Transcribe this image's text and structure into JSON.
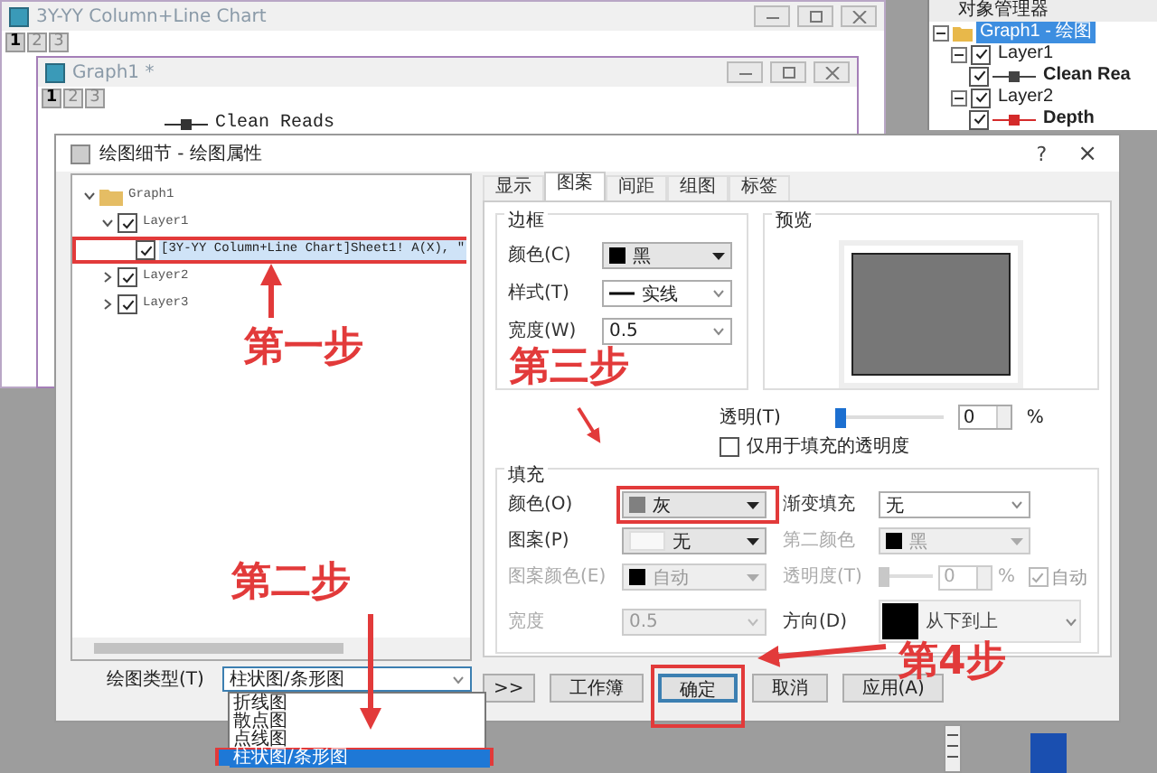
{
  "background_window": {
    "title": "3Y-YY Column+Line Chart",
    "page_tabs": [
      {
        "label": "1",
        "selected": true
      },
      {
        "label": "2",
        "selected": false
      },
      {
        "label": "3",
        "selected": false
      }
    ]
  },
  "graph_window": {
    "title": "Graph1 *",
    "page_tabs": [
      {
        "label": "1",
        "selected": true
      },
      {
        "label": "2",
        "selected": false
      },
      {
        "label": "3",
        "selected": false
      }
    ],
    "legend": "Clean Reads"
  },
  "object_manager": {
    "title": "对象管理器",
    "tree": [
      {
        "label": "Graph1 - 绘图",
        "kind": "graph",
        "selected": true,
        "children": [
          {
            "label": "Layer1",
            "kind": "layer",
            "checked": true,
            "selected": false,
            "children": [
              {
                "label": "Clean Rea",
                "kind": "plot",
                "checked": true,
                "selected": false,
                "color": "#444444"
              }
            ]
          },
          {
            "label": "Layer2",
            "kind": "layer",
            "checked": true,
            "selected": false,
            "children": [
              {
                "label": "Depth",
                "kind": "plot",
                "checked": true,
                "selected": false,
                "color": "#d42a2a"
              }
            ]
          }
        ]
      }
    ]
  },
  "dialog": {
    "title": "绘图细节 - 绘图属性",
    "help": "?",
    "close": "×"
  },
  "plot_tree": [
    {
      "label": "Graph1",
      "expanded": true,
      "selected": false,
      "highlighted": false,
      "children": [
        {
          "label": "Layer1",
          "expanded": true,
          "checked": true,
          "selected": false,
          "highlighted": false,
          "children": [
            {
              "label": "[3Y-YY Column+Line Chart]Sheet1! A(X), \"",
              "checked": true,
              "selected": true,
              "highlighted": true
            }
          ]
        },
        {
          "label": "Layer2",
          "expanded": false,
          "checked": true,
          "selected": false,
          "highlighted": false
        },
        {
          "label": "Layer3",
          "expanded": false,
          "checked": true,
          "selected": false,
          "highlighted": false
        }
      ]
    }
  ],
  "plot_type": {
    "label": "绘图类型(T)",
    "value": "柱状图/条形图",
    "options": [
      {
        "label": "折线图",
        "selected": false,
        "highlighted": false
      },
      {
        "label": "散点图",
        "selected": false,
        "highlighted": false
      },
      {
        "label": "点线图",
        "selected": false,
        "highlighted": false
      },
      {
        "label": "柱状图/条形图",
        "selected": true,
        "highlighted": true
      }
    ]
  },
  "tabs": [
    {
      "label": "显示",
      "selected": false
    },
    {
      "label": "图案",
      "selected": true
    },
    {
      "label": "间距",
      "selected": false
    },
    {
      "label": "组图",
      "selected": false
    },
    {
      "label": "标签",
      "selected": false
    }
  ],
  "border_group": {
    "title": "边框",
    "fields": [
      {
        "label": "颜色(C)",
        "kind": "color",
        "value": "黑",
        "color": "#000000",
        "disabled": false
      },
      {
        "label": "样式(T)",
        "kind": "line",
        "value": "实线",
        "disabled": false
      },
      {
        "label": "宽度(W)",
        "kind": "select",
        "value": "0.5",
        "disabled": false
      }
    ]
  },
  "preview": {
    "title": "预览"
  },
  "transparency": {
    "label": "透明(T)",
    "level": 0,
    "value": "0",
    "unit": "%"
  },
  "fill_only": {
    "label": "仅用于填充的透明度",
    "checked": false
  },
  "fill_group": {
    "title": "填充",
    "left_fields": [
      {
        "label": "颜色(O)",
        "kind": "color",
        "value": "灰",
        "color": "#808080",
        "disabled": false,
        "highlighted": true
      },
      {
        "label": "图案(P)",
        "kind": "pattern",
        "value": "无",
        "disabled": false,
        "highlighted": false
      },
      {
        "label": "图案颜色(E)",
        "kind": "color",
        "value": "自动",
        "color": "#000000",
        "disabled": true,
        "highlighted": false
      },
      {
        "label": "宽度",
        "kind": "select",
        "value": "0.5",
        "disabled": true,
        "highlighted": false
      }
    ],
    "right_fields": [
      {
        "label": "渐变填充",
        "kind": "select",
        "value": "无",
        "disabled": false,
        "highlighted": false
      },
      {
        "label": "第二颜色",
        "kind": "color",
        "value": "黑",
        "color": "#000000",
        "disabled": true,
        "highlighted": false
      },
      {
        "label": "透明度(T)",
        "kind": "slider",
        "level": 0,
        "value": "0",
        "unit": "%",
        "check_label": "自动",
        "checked": true,
        "disabled": true,
        "highlighted": false
      },
      {
        "label": "方向(D)",
        "kind": "direction",
        "value": "从下到上",
        "color": "#000000",
        "disabled": false,
        "highlighted": false
      }
    ]
  },
  "buttons": [
    {
      "label": ">>",
      "focused": false,
      "highlighted": false
    },
    {
      "label": "工作簿",
      "focused": false,
      "highlighted": false
    },
    {
      "label": "确定",
      "focused": true,
      "highlighted": true
    },
    {
      "label": "取消",
      "focused": false,
      "highlighted": false
    },
    {
      "label": "应用(A)",
      "focused": false,
      "highlighted": false
    }
  ],
  "annotations": [
    {
      "text": "第一步"
    },
    {
      "text": "第二步"
    },
    {
      "text": "第三步"
    },
    {
      "text": "第4步"
    }
  ]
}
